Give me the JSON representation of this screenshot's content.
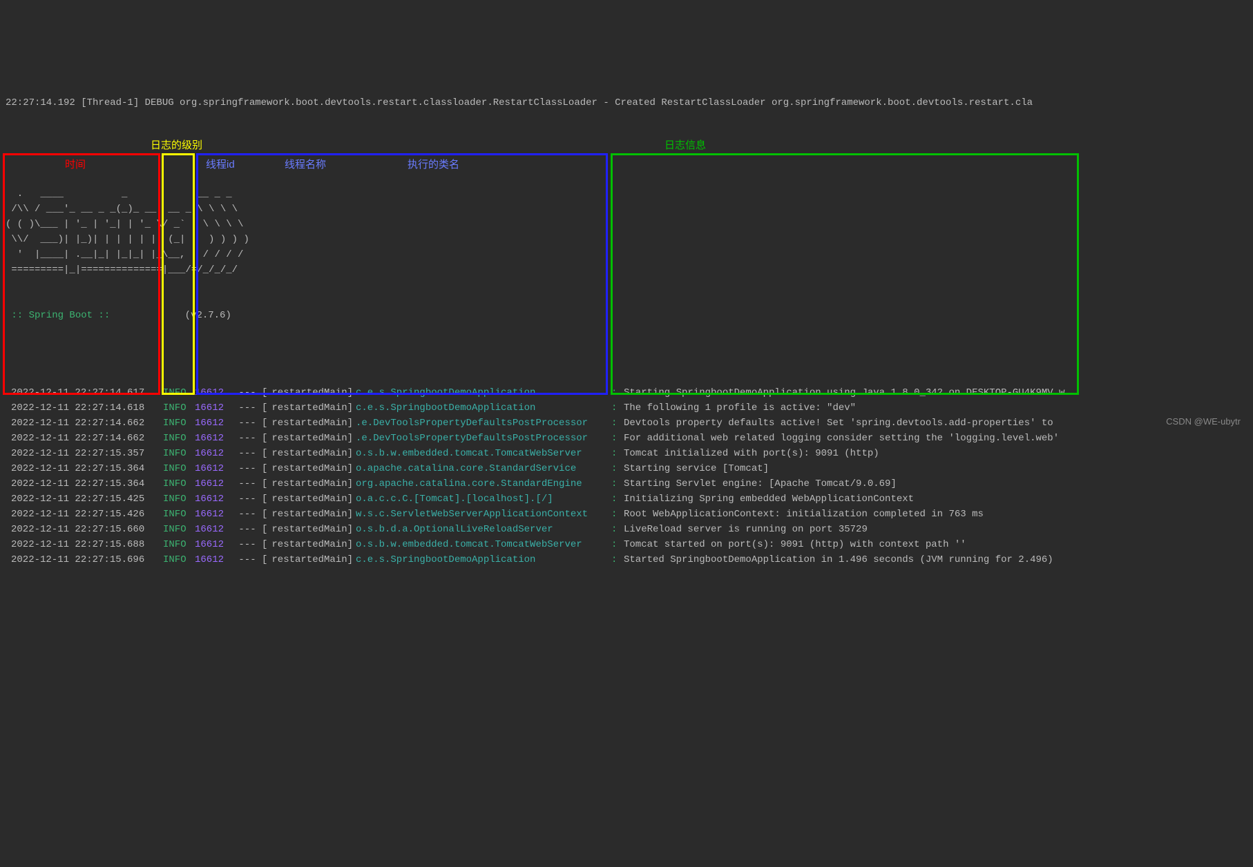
{
  "header_debug_line": "22:27:14.192 [Thread-1] DEBUG org.springframework.boot.devtools.restart.classloader.RestartClassLoader - Created RestartClassLoader org.springframework.boot.devtools.restart.cla",
  "ascii_art": "  .   ____          _            __ _ _\n /\\\\ / ___'_ __ _ _(_)_ __  __ _ \\ \\ \\ \\\n( ( )\\___ | '_ | '_| | '_ \\/ _` | \\ \\ \\ \\\n \\\\/  ___)| |_)| | | | | || (_| |  ) ) ) )\n  '  |____| .__|_| |_|_| |_\\__, | / / / /\n =========|_|==============|___/=/_/_/_/",
  "spring_boot_label": " :: Spring Boot :: ",
  "spring_boot_version": "(v2.7.6)",
  "annotations": {
    "log_level": "日志的级别",
    "log_info": "日志信息",
    "time": "时间",
    "pid": "线程id",
    "thread_name": "线程名称",
    "class_name": "执行的类名"
  },
  "log_separator": " --- [",
  "log_colon": ":",
  "log_rows": [
    {
      "time": "2022-12-11 22:27:14.617",
      "level": "INFO",
      "pid": "16612",
      "thread": " restartedMain]",
      "class": "c.e.s.SpringbootDemoApplication",
      "msg": "Starting SpringbootDemoApplication using Java 1.8.0_342 on DESKTOP-GU4K9MV w"
    },
    {
      "time": "2022-12-11 22:27:14.618",
      "level": "INFO",
      "pid": "16612",
      "thread": " restartedMain]",
      "class": "c.e.s.SpringbootDemoApplication",
      "msg": "The following 1 profile is active: \"dev\""
    },
    {
      "time": "2022-12-11 22:27:14.662",
      "level": "INFO",
      "pid": "16612",
      "thread": " restartedMain]",
      "class": ".e.DevToolsPropertyDefaultsPostProcessor",
      "msg": "Devtools property defaults active! Set 'spring.devtools.add-properties' to "
    },
    {
      "time": "2022-12-11 22:27:14.662",
      "level": "INFO",
      "pid": "16612",
      "thread": " restartedMain]",
      "class": ".e.DevToolsPropertyDefaultsPostProcessor",
      "msg": "For additional web related logging consider setting the 'logging.level.web'"
    },
    {
      "time": "2022-12-11 22:27:15.357",
      "level": "INFO",
      "pid": "16612",
      "thread": " restartedMain]",
      "class": "o.s.b.w.embedded.tomcat.TomcatWebServer",
      "msg": "Tomcat initialized with port(s): 9091 (http)"
    },
    {
      "time": "2022-12-11 22:27:15.364",
      "level": "INFO",
      "pid": "16612",
      "thread": " restartedMain]",
      "class": "o.apache.catalina.core.StandardService",
      "msg": "Starting service [Tomcat]"
    },
    {
      "time": "2022-12-11 22:27:15.364",
      "level": "INFO",
      "pid": "16612",
      "thread": " restartedMain]",
      "class": "org.apache.catalina.core.StandardEngine",
      "msg": "Starting Servlet engine: [Apache Tomcat/9.0.69]"
    },
    {
      "time": "2022-12-11 22:27:15.425",
      "level": "INFO",
      "pid": "16612",
      "thread": " restartedMain]",
      "class": "o.a.c.c.C.[Tomcat].[localhost].[/]",
      "msg": "Initializing Spring embedded WebApplicationContext"
    },
    {
      "time": "2022-12-11 22:27:15.426",
      "level": "INFO",
      "pid": "16612",
      "thread": " restartedMain]",
      "class": "w.s.c.ServletWebServerApplicationContext",
      "msg": "Root WebApplicationContext: initialization completed in 763 ms"
    },
    {
      "time": "2022-12-11 22:27:15.660",
      "level": "INFO",
      "pid": "16612",
      "thread": " restartedMain]",
      "class": "o.s.b.d.a.OptionalLiveReloadServer",
      "msg": "LiveReload server is running on port 35729"
    },
    {
      "time": "2022-12-11 22:27:15.688",
      "level": "INFO",
      "pid": "16612",
      "thread": " restartedMain]",
      "class": "o.s.b.w.embedded.tomcat.TomcatWebServer",
      "msg": "Tomcat started on port(s): 9091 (http) with context path ''"
    },
    {
      "time": "2022-12-11 22:27:15.696",
      "level": "INFO",
      "pid": "16612",
      "thread": " restartedMain]",
      "class": "c.e.s.SpringbootDemoApplication",
      "msg": "Started SpringbootDemoApplication in 1.496 seconds (JVM running for 2.496)"
    }
  ],
  "watermark": "CSDN @WE-ubytr"
}
